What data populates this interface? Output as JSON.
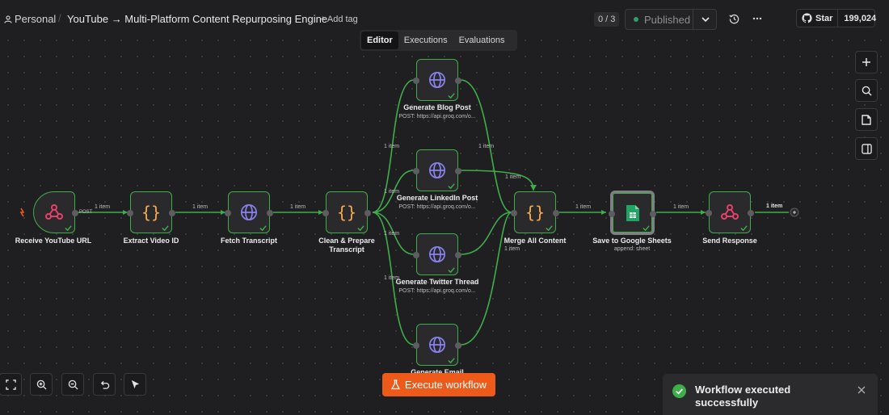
{
  "header": {
    "workspace": "Personal",
    "workflow_title": "YouTube → Multi-Platform Content Repurposing Engine",
    "add_tag": "+ Add tag",
    "counter": "0 / 3",
    "status": "Published",
    "github_star": "Star",
    "github_count": "199,024"
  },
  "tabs": [
    "Editor",
    "Executions",
    "Evaluations"
  ],
  "nodes": {
    "receive": {
      "label": "Receive YouTube URL"
    },
    "extract": {
      "label": "Extract Video ID"
    },
    "fetch": {
      "label": "Fetch Transcript"
    },
    "clean": {
      "label": "Clean & Prepare Transcript"
    },
    "blog": {
      "label": "Generate Blog Post",
      "sub": "POST: https://api.groq.com/o..."
    },
    "linkedin": {
      "label": "Generate LinkedIn Post",
      "sub": "POST: https://api.groq.com/o..."
    },
    "twitter": {
      "label": "Generate Twitter Thread",
      "sub": "POST: https://api.groq.com/o..."
    },
    "email": {
      "label": "Generate Email"
    },
    "merge": {
      "label": "Merge All Content"
    },
    "sheets": {
      "label": "Save to Google Sheets",
      "sub": "append: sheet"
    },
    "respond": {
      "label": "Send Response"
    }
  },
  "edge_labels": {
    "item": "1 item",
    "post": "POST"
  },
  "execute_button": "Execute workflow",
  "toast": {
    "message": "Workflow executed successfully"
  },
  "colors": {
    "success": "#3fae4a",
    "accent": "#ee5a1a",
    "webhook": "#e5416b",
    "code": "#f7a94b",
    "http": "#8b82f0",
    "sheets": "#1fa463"
  }
}
